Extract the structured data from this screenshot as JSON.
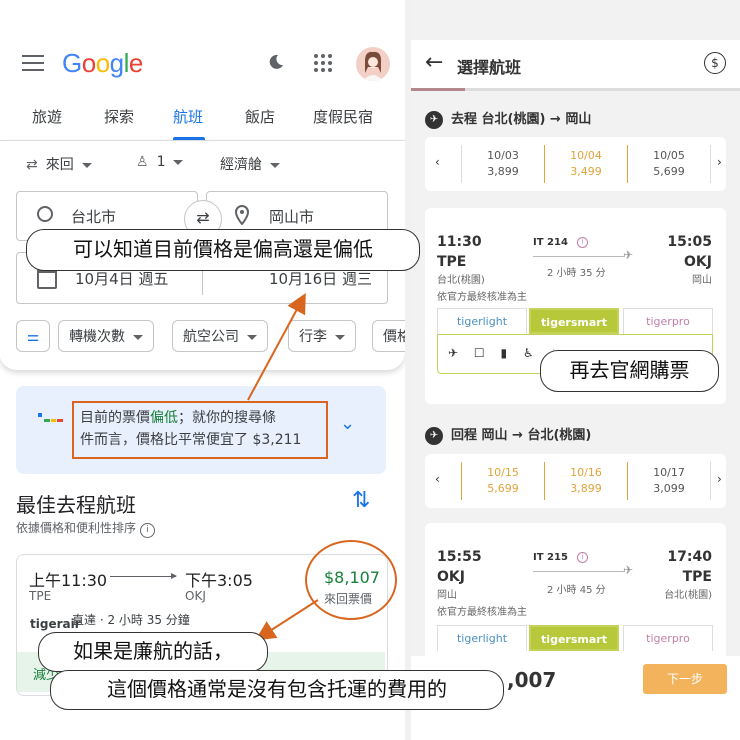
{
  "left": {
    "logo": "Google",
    "tabs": [
      "旅遊",
      "探索",
      "航班",
      "飯店",
      "度假民宿"
    ],
    "active_tab": "航班",
    "options": {
      "trip_type": "來回",
      "passengers": "1",
      "cabin": "經濟艙"
    },
    "origin": "台北市",
    "destination": "岡山市",
    "depart_date": "10月4日 週五",
    "return_date": "10月16日 週三",
    "filters": [
      "轉機次數",
      "航空公司",
      "行李",
      "價格"
    ],
    "insight": {
      "line1_pre": "目前的票價",
      "line1_low": "偏低",
      "line1_post": "；就你的搜尋條",
      "line2": "件而言，價格比平常便宜了 $3,211"
    },
    "best": {
      "title": "最佳去程航班",
      "subtitle": "依據價格和便利性排序"
    },
    "flight": {
      "depart_time": "上午11:30",
      "arrive_time": "下午3:05",
      "depart_code": "TPE",
      "arrive_code": "OKJ",
      "airline": "tigerair",
      "info": "直達 · 2 小時 35 分鐘",
      "price": "$8,107",
      "price_note": "來回票價",
      "green_note": "減少"
    }
  },
  "annotations": {
    "top": "可以知道目前價格是偏高還是偏低",
    "lcc_line1": "如果是廉航的話，",
    "lcc_line2": "這個價格通常是沒有包含托運的費用的",
    "official": "再去官網購票"
  },
  "right": {
    "title": "選擇航班",
    "outbound": {
      "label": "去程  台北(桃園) → 岡山",
      "dates": [
        {
          "date": "10/03",
          "price": "3,899",
          "selected": false
        },
        {
          "date": "10/04",
          "price": "3,499",
          "selected": true
        },
        {
          "date": "10/05",
          "price": "5,699",
          "selected": false
        }
      ],
      "flight": {
        "dep_time": "11:30",
        "arr_time": "15:05",
        "dep_code": "TPE",
        "arr_code": "OKJ",
        "dep_city": "台北(桃園)",
        "arr_city": "岡山",
        "flight_no": "IT 214",
        "duration": "2 小時 35 分",
        "note": "依官方最終核准為主"
      }
    },
    "inbound": {
      "label": "回程  岡山 → 台北(桃園)",
      "dates": [
        {
          "date": "10/15",
          "price": "5,699",
          "selected": true
        },
        {
          "date": "10/16",
          "price": "3,899",
          "selected": true
        },
        {
          "date": "10/17",
          "price": "3,099",
          "selected": false
        }
      ],
      "flight": {
        "dep_time": "15:55",
        "arr_time": "17:40",
        "dep_code": "OKJ",
        "arr_code": "TPE",
        "dep_city": "岡山",
        "arr_city": "台北(桃園)",
        "flight_no": "IT 215",
        "duration": "2 小時 45 分",
        "note": "依官方最終核准為主"
      }
    },
    "fares": [
      "tigerlight",
      "tigersmart",
      "tigerpro"
    ],
    "total": ",007",
    "next": "下一步"
  },
  "colors": {
    "accent_blue": "#1a73e8",
    "annotation_orange": "#d9661f",
    "tiger_green": "#b7c93b",
    "tiger_orange": "#f2b35c"
  }
}
